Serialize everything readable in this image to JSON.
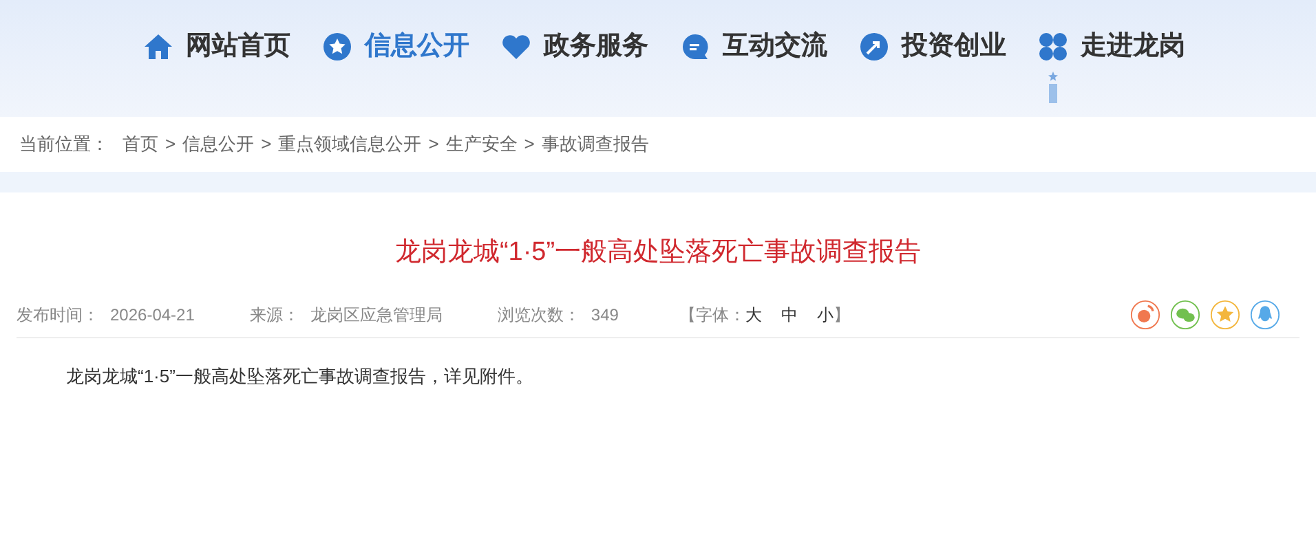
{
  "nav": [
    {
      "label": "网站首页",
      "kind": "home",
      "selected": false
    },
    {
      "label": "信息公开",
      "kind": "star",
      "selected": true
    },
    {
      "label": "政务服务",
      "kind": "heart",
      "selected": false
    },
    {
      "label": "互动交流",
      "kind": "chat",
      "selected": false
    },
    {
      "label": "投资创业",
      "kind": "arrow",
      "selected": false
    },
    {
      "label": "走进龙岗",
      "kind": "clover",
      "selected": false
    }
  ],
  "breadcrumb": {
    "prefix": "当前位置：",
    "separator": ">",
    "items": [
      "首页",
      "信息公开",
      "重点领域信息公开",
      "生产安全",
      "事故调查报告"
    ]
  },
  "article": {
    "title": "龙岗龙城“1·5”一般高处坠落死亡事故调查报告",
    "meta": [
      {
        "label": "发布时间：",
        "value": "2026-04-21"
      },
      {
        "label": "来源：",
        "value": "龙岗区应急管理局"
      },
      {
        "label": "浏览次数：",
        "value": "349"
      }
    ],
    "font_size": {
      "open": "【字体：",
      "sizes": [
        "大",
        "中",
        "小"
      ],
      "close": "】"
    },
    "share": [
      {
        "kind": "weibo",
        "color": "#f0784f"
      },
      {
        "kind": "wechat",
        "color": "#72c04f"
      },
      {
        "kind": "favorite",
        "color": "#f3b63c"
      },
      {
        "kind": "qq",
        "color": "#56a9e8"
      }
    ],
    "body": "龙岗龙城“1·5”一般高处坠落死亡事故调查报告，详见附件。"
  }
}
